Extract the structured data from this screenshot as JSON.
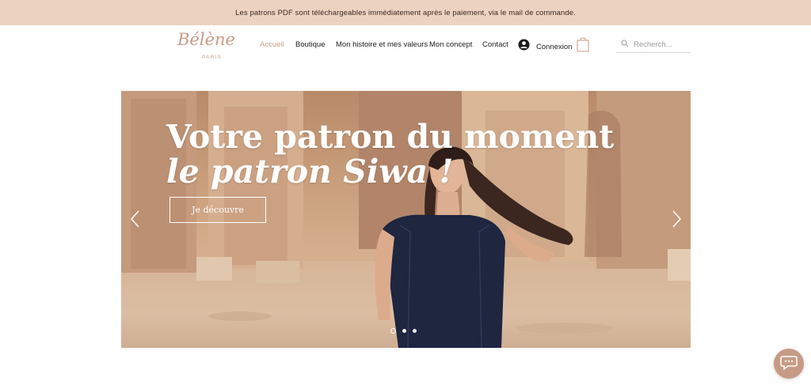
{
  "announcement": "Les patrons PDF sont téléchargeables immédiatement après le paiement, via le mail de commande.",
  "logo": {
    "script": "Bélène",
    "sub": "PARIS"
  },
  "nav": {
    "items": [
      {
        "label": "Accueil",
        "active": true
      },
      {
        "label": "Boutique"
      },
      {
        "label": "Mon histoire et mes valeurs"
      },
      {
        "label": "Mon concept"
      },
      {
        "label": "Contact"
      }
    ]
  },
  "login": {
    "label": "Connexion",
    "icon": "user-circle-icon"
  },
  "cart": {
    "icon": "shopping-bag-icon"
  },
  "search": {
    "placeholder": "Recherch...",
    "icon": "search-icon"
  },
  "hero": {
    "title": "Votre patron du moment",
    "subtitle": "le patron Siwa !",
    "cta_label": "Je découvre",
    "slides": 3,
    "active_slide": 1
  },
  "chat": {
    "icon": "chat-bubble-icon"
  },
  "colors": {
    "announcement_bg": "#ecd3c1",
    "accent": "#c79a86",
    "active_nav": "#c8a08e"
  }
}
